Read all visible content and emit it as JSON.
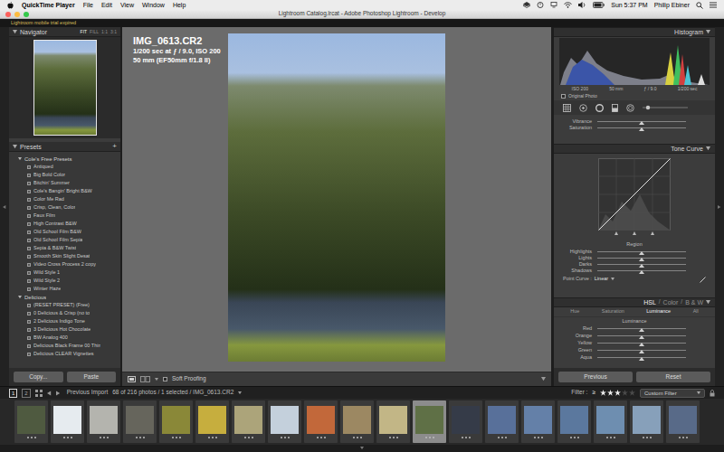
{
  "menubar": {
    "app": "QuickTime Player",
    "menus": [
      "File",
      "Edit",
      "View",
      "Window",
      "Help"
    ],
    "clock": "Sun 5:37 PM",
    "user": "Philip Ebiner"
  },
  "window": {
    "title": "Lightroom Catalog.lrcat - Adobe Photoshop Lightroom - Develop",
    "notice": "Lightroom mobile trial expired"
  },
  "navigator": {
    "title": "Navigator",
    "zoom": [
      {
        "label": "FIT",
        "selected": true
      },
      {
        "label": "FILL",
        "selected": false
      },
      {
        "label": "1:1",
        "selected": false
      },
      {
        "label": "3:1",
        "selected": false
      }
    ]
  },
  "presets": {
    "title": "Presets",
    "add": "+",
    "groups": [
      {
        "name": "Cole's Free Presets",
        "expanded": true,
        "items": [
          "Antiqued",
          "Big Bold Color",
          "Bitchin' Summer",
          "Cole's Bangin' Bright B&W",
          "Color Me Rad",
          "Crisp, Clean, Color",
          "Faux Film",
          "High Contrast B&W",
          "Old School Film B&W",
          "Old School Film Sepia",
          "Sepia & B&W Twist",
          "Smooth Skin Slight Desat",
          "Video Cross Process 2 copy",
          "Wild Style 1",
          "Wild Style 2",
          "Winter Haze"
        ]
      },
      {
        "name": "Delicious",
        "expanded": true,
        "items": [
          "(RESET PRESET) (Free)",
          "0 Delicious & Crisp (no to",
          "2 Delicious Indigo Tone",
          "3 Delicious Hot Chocolate",
          "BW Analog 400",
          "Delicious Black Frame 00 Thin",
          "Delicious CLEAR Vignettes"
        ]
      }
    ]
  },
  "left_buttons": [
    "Copy...",
    "Paste"
  ],
  "photo": {
    "filename": "IMG_0613.CR2",
    "exposure": "1/200 sec at ƒ / 9.0, ISO 200",
    "lens": "50 mm (EF50mm f/1.8 II)"
  },
  "toolbar": {
    "soft_proofing": {
      "label": "Soft Proofing",
      "checked": false
    }
  },
  "histogram": {
    "title": "Histogram",
    "info": [
      "ISO 200",
      "50 mm",
      "ƒ / 9.0",
      "1/200 sec"
    ],
    "original_photo": {
      "label": "Original Photo",
      "checked": false
    }
  },
  "basic_sliders": [
    {
      "label": "Vibrance",
      "level": 0.5
    },
    {
      "label": "Saturation",
      "level": 0.5
    }
  ],
  "tone_curve": {
    "title": "Tone Curve",
    "region": "Region",
    "sliders": [
      {
        "label": "Highlights",
        "level": 0.5
      },
      {
        "label": "Lights",
        "level": 0.5
      },
      {
        "label": "Darks",
        "level": 0.5
      },
      {
        "label": "Shadows",
        "level": 0.5
      }
    ],
    "point_curve_label": "Point Curve :",
    "point_curve_value": "Linear"
  },
  "hsl": {
    "separator": "/",
    "tabs": [
      {
        "label": "HSL",
        "selected": true
      },
      {
        "label": "Color",
        "selected": false
      },
      {
        "label": "B & W",
        "selected": false
      }
    ],
    "subtabs": [
      {
        "label": "Hue",
        "selected": false
      },
      {
        "label": "Saturation",
        "selected": false
      },
      {
        "label": "Luminance",
        "selected": true
      },
      {
        "label": "All",
        "selected": false
      }
    ],
    "group": "Luminance",
    "sliders": [
      {
        "label": "Red",
        "level": 0.5
      },
      {
        "label": "Orange",
        "level": 0.5
      },
      {
        "label": "Yellow",
        "level": 0.5
      },
      {
        "label": "Green",
        "level": 0.5
      },
      {
        "label": "Aqua",
        "level": 0.5
      }
    ]
  },
  "right_buttons": [
    "Previous",
    "Reset"
  ],
  "filmstrip": {
    "screens": [
      {
        "label": "1",
        "selected": true
      },
      {
        "label": "2",
        "selected": false
      }
    ],
    "source": "Previous Import",
    "info": "68 of 216 photos / 1 selected / IMG_0613.CR2",
    "filter": {
      "label": "Filter :",
      "operator": "≥",
      "stars": 3,
      "preset": "Custom Filter"
    },
    "thumbs": [
      {
        "color": "#4f5a40",
        "selected": false
      },
      {
        "color": "#e6ebef",
        "selected": false
      },
      {
        "color": "#b4b4ae",
        "selected": false
      },
      {
        "color": "#66655c",
        "selected": false
      },
      {
        "color": "#8a8838",
        "selected": false
      },
      {
        "color": "#c6ae3e",
        "selected": false
      },
      {
        "color": "#aca47a",
        "selected": false
      },
      {
        "color": "#c4d0dc",
        "selected": false
      },
      {
        "color": "#c2683a",
        "selected": false
      },
      {
        "color": "#9c8862",
        "selected": false
      },
      {
        "color": "#c2b686",
        "selected": false
      },
      {
        "color": "#5f7046",
        "selected": true
      },
      {
        "color": "#353b48",
        "selected": false
      },
      {
        "color": "#58709a",
        "selected": false
      },
      {
        "color": "#6480a8",
        "selected": false
      },
      {
        "color": "#5b789e",
        "selected": false
      },
      {
        "color": "#6e8eb0",
        "selected": false
      },
      {
        "color": "#87a0ba",
        "selected": false
      },
      {
        "color": "#586a88",
        "selected": false
      }
    ]
  }
}
